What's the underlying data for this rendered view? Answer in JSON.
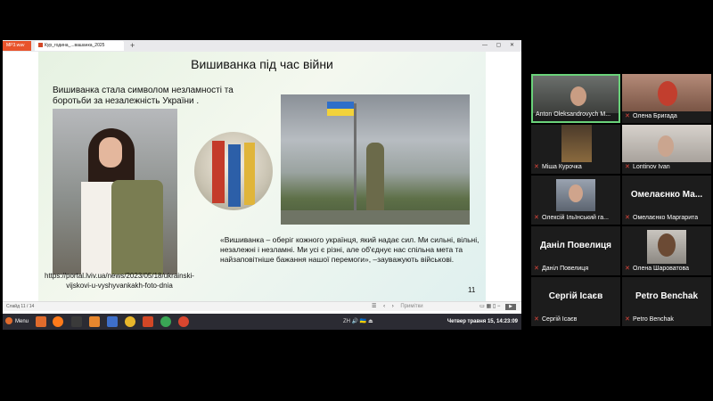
{
  "browser": {
    "tab1_label": "MP3.wav",
    "tab2_label": "Кур_годинa_...вашанка_2025",
    "new_tab": "+",
    "window_controls": "— ▢ ✕"
  },
  "slide": {
    "title": "Вишиванка під час війни",
    "subtitle": "Вишиванка стала символом незламності та боротьби за незалежність України .",
    "url": "https://portal.lviv.ua/news/2023/05/18/ukrainski-vijskovi-u-vyshyvankakh-foto-dnia",
    "quote": "«Вишиванка – оберіг кожного українця, який надає сил. Ми сильні, вільні, незалежні і незламні. Ми усі є різні, але об'єднує нас спільна мета та найзаповітніше бажання нашої перемоги», –зауважують військові.",
    "page_number": "11"
  },
  "statusbar": {
    "slide_count": "Слайд 11 / 14",
    "notes": "Примітки"
  },
  "taskbar": {
    "menu_label": "Menu",
    "tray_text": "ZH  🔊  🇺🇦  ⏏",
    "clock": "Четвер травня 15, 14:23:09"
  },
  "participants": [
    {
      "name": "Anton Oleksandrovych M...",
      "big_name": "",
      "active": true
    },
    {
      "name": "Олена Бригада",
      "big_name": "",
      "active": false
    },
    {
      "name": "Міша Курочка",
      "big_name": "",
      "active": false
    },
    {
      "name": "Lontinov Ivan",
      "big_name": "",
      "active": false
    },
    {
      "name": "Олексій Ільїнський га...",
      "big_name": "",
      "active": false
    },
    {
      "name": "Омелаєнко Маргарита",
      "big_name": "Омелаєнко Ма...",
      "active": false
    },
    {
      "name": "Даніл Повелиця",
      "big_name": "Даніл Повелиця",
      "active": false
    },
    {
      "name": "Олена Шароватова",
      "big_name": "",
      "active": false
    },
    {
      "name": "Сергій Ісаєв",
      "big_name": "Сергій Ісаєв",
      "active": false
    },
    {
      "name": "Petro Benchak",
      "big_name": "Petro Benchak",
      "active": false
    }
  ],
  "colors": {
    "active_border": "#6ad27a",
    "muted_mic": "#e0463c",
    "taskbar": "#2b2b33"
  }
}
